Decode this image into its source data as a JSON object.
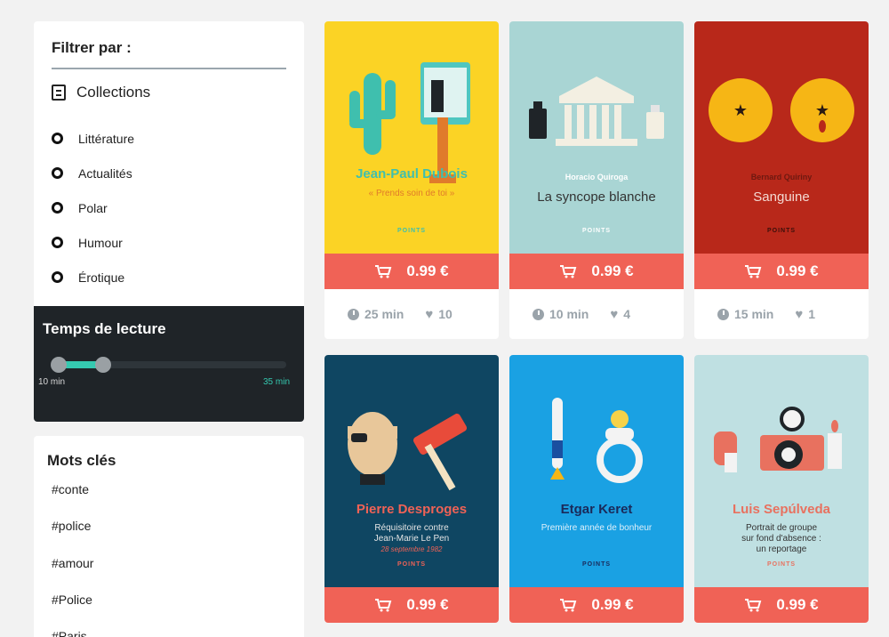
{
  "filters": {
    "title": "Filtrer par :",
    "collections_label": "Collections",
    "options": [
      "Littérature",
      "Actualités",
      "Polar",
      "Humour",
      "Érotique"
    ]
  },
  "reading_time": {
    "title": "Temps de lecture",
    "min_label": "10 min",
    "max_label": "35 min",
    "accent_color": "#35c9b0"
  },
  "keywords": {
    "title": "Mots clés",
    "tags": [
      "#conte",
      "#police",
      "#amour",
      "#Police",
      "#Paris"
    ]
  },
  "brand_color": "#f06256",
  "books": [
    {
      "author": "Jean-Paul Dubois",
      "title": "« Prends soin de toi »",
      "brand": "POINTS",
      "price": "0.99 €",
      "time": "25 min",
      "likes": "10",
      "cover_color": "#fbd325"
    },
    {
      "author": "Horacio Quiroga",
      "title": "La syncope blanche",
      "brand": "POINTS",
      "price": "0.99 €",
      "time": "10 min",
      "likes": "4",
      "cover_color": "#a9d5d4"
    },
    {
      "author": "Bernard Quiriny",
      "title": "Sanguine",
      "brand": "POINTS",
      "price": "0.99 €",
      "time": "15 min",
      "likes": "1",
      "cover_color": "#b8281a"
    },
    {
      "author": "Pierre Desproges",
      "title": "Réquisitoire contre\nJean-Marie Le Pen",
      "subtitle": "28 septembre 1982",
      "brand": "POINTS",
      "price": "0.99 €",
      "cover_color": "#0f4662"
    },
    {
      "author": "Etgar Keret",
      "title": "Première année de bonheur",
      "brand": "POINTS",
      "price": "0.99 €",
      "cover_color": "#1aa1e3"
    },
    {
      "author": "Luis Sepúlveda",
      "title": "Portrait de groupe\nsur fond d'absence :\nun reportage",
      "brand": "POINTS",
      "price": "0.99 €",
      "cover_color": "#bfe0e2"
    }
  ]
}
